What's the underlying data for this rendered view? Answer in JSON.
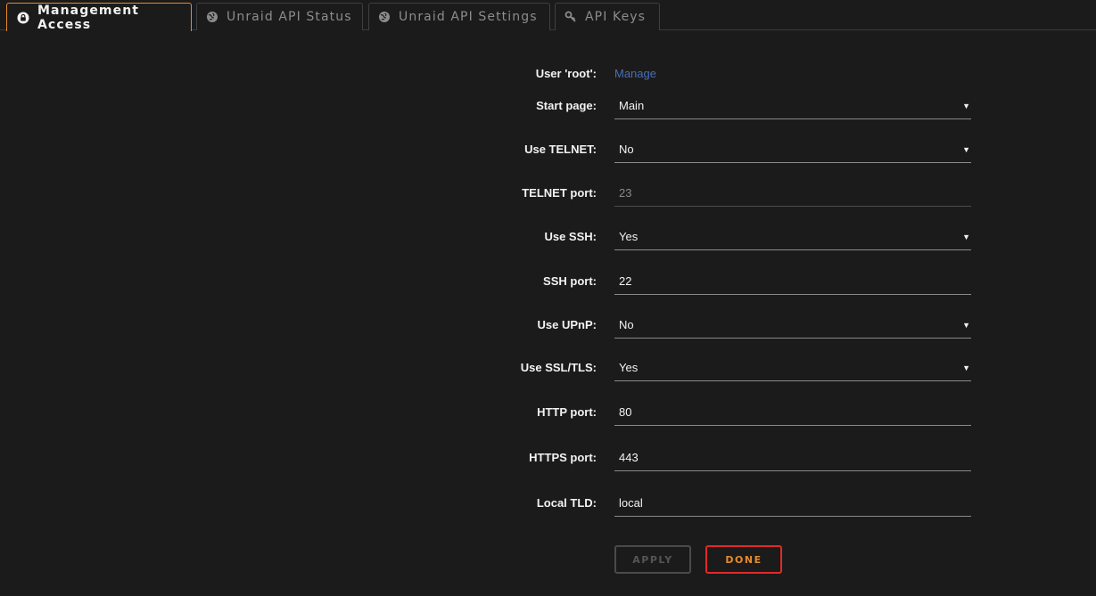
{
  "tabs": [
    {
      "label": "Management Access",
      "icon": "lock-icon",
      "active": true
    },
    {
      "label": "Unraid API Status",
      "icon": "globe-icon",
      "active": false
    },
    {
      "label": "Unraid API Settings",
      "icon": "globe-icon",
      "active": false
    },
    {
      "label": "API Keys",
      "icon": "key-icon",
      "active": false
    }
  ],
  "form": {
    "user_root": {
      "label": "User 'root':",
      "link": "Manage"
    },
    "start_page": {
      "label": "Start page:",
      "value": "Main"
    },
    "use_telnet": {
      "label": "Use TELNET:",
      "value": "No"
    },
    "telnet_port": {
      "label": "TELNET port:",
      "value": "23"
    },
    "use_ssh": {
      "label": "Use SSH:",
      "value": "Yes"
    },
    "ssh_port": {
      "label": "SSH port:",
      "value": "22"
    },
    "use_upnp": {
      "label": "Use UPnP:",
      "value": "No"
    },
    "use_ssl": {
      "label": "Use SSL/TLS:",
      "value": "Yes"
    },
    "http_port": {
      "label": "HTTP port:",
      "value": "80"
    },
    "https_port": {
      "label": "HTTPS port:",
      "value": "443"
    },
    "local_tld": {
      "label": "Local TLD:",
      "value": "local"
    }
  },
  "buttons": {
    "apply": "APPLY",
    "done": "DONE"
  },
  "colors": {
    "accent": "#e68a2e",
    "done_border": "#e22828",
    "link": "#486dba",
    "background": "#1c1b1b"
  }
}
